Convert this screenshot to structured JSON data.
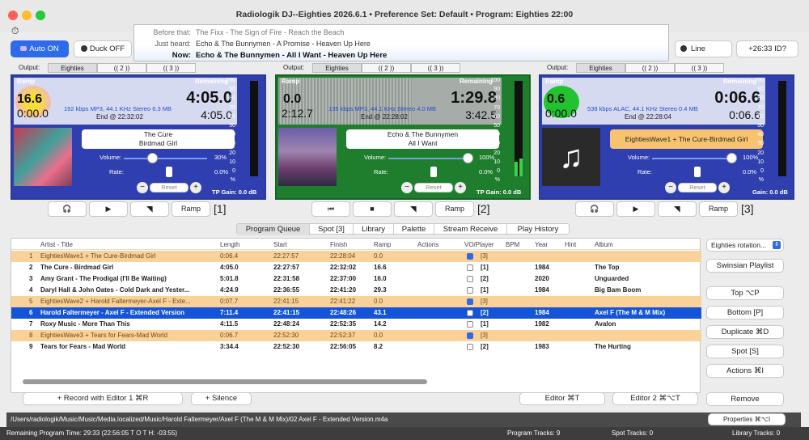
{
  "window": {
    "title": "Radiologik DJ--Eighties 2026.6.1   •   Preference Set: Default   •   Program: Eighties 22:00"
  },
  "toolbar": {
    "auto_label": "Auto ON",
    "duck_label": "Duck OFF",
    "line_label": "Line",
    "time_label": "+26:33  ID?"
  },
  "now_playing": {
    "before_label": "Before that:",
    "before_value": "The Fixx - The Sign of Fire - Reach the Beach",
    "just_label": "Just heard:",
    "just_value": "Echo & The Bunnymen - A Promise - Heaven Up Here",
    "now_label": "Now:",
    "now_value": "Echo & The Bunnymen - All I Want - Heaven Up Here"
  },
  "outputs": [
    {
      "label": "Output:",
      "tabs": [
        "Eighties",
        "(( 2 ))",
        "(( 3 ))"
      ]
    },
    {
      "label": "Output:",
      "tabs": [
        "Eighties",
        "(( 2 ))",
        "(( 3 ))"
      ]
    },
    {
      "label": "Output:",
      "tabs": [
        "Eighties",
        "(( 2 ))",
        "(( 3 ))"
      ]
    }
  ],
  "meter_scale": [
    "100",
    "90",
    "80",
    "70",
    "60",
    "50",
    "40",
    "30",
    "20",
    "10",
    "0",
    "%"
  ],
  "decks": [
    {
      "ramp_label": "Ramp",
      "remaining_label": "Remaining",
      "ramp_value": "16.6",
      "elapsed": "0:00.0",
      "remaining_big": "4:05.0",
      "remaining_small": "4:05.0",
      "format": "192 kbps MP3, 44.1 KHz Stereo 6.3 MB",
      "end": "End @ 22:32:02",
      "artist": "The Cure",
      "title": "Birdmad Girl",
      "volume_label": "Volume:",
      "volume_value": "30%",
      "rate_label": "Rate:",
      "rate_value": "0.0%",
      "reset_label": "Reset",
      "gain": "TP Gain: 0.0 dB",
      "color": "#2f3fb0"
    },
    {
      "ramp_label": "Ramp",
      "remaining_label": "Remaining",
      "ramp_value": "0.0",
      "elapsed": "2:12.7",
      "remaining_big": "1:29.8",
      "remaining_small": "3:42.5",
      "format": "135 kbps MP3, 44.1 KHz Stereo 4.0 MB",
      "end": "End @ 22:28:02",
      "artist": "Echo & The Bunnymen",
      "title": "All I Want",
      "volume_label": "Volume:",
      "volume_value": "100%",
      "rate_label": "Rate:",
      "rate_value": "0.0%",
      "reset_label": "Reset",
      "gain": "TP Gain: 0.0 dB",
      "color": "#1f7d2e"
    },
    {
      "ramp_label": "Ramp",
      "remaining_label": "Remaining",
      "ramp_value": "0.6",
      "elapsed": "0:00.0",
      "remaining_big": "0:06.6",
      "remaining_small": "0:06.6",
      "format": "538 kbps ALAC, 44.1 KHz Stereo 0.4 MB",
      "end": "End @ 22:28:04",
      "artist": "EightiesWave1 + The Cure-Birdmad Girl",
      "title": "",
      "volume_label": "Volume:",
      "volume_value": "100%",
      "rate_label": "Rate:",
      "rate_value": "0.0%",
      "reset_label": "Reset",
      "gain": "Gain: 0.0 dB",
      "color": "#2f3fb0"
    }
  ],
  "deck_controls": [
    {
      "ramp_label": "Ramp",
      "num": "[1]"
    },
    {
      "ramp_label": "Ramp",
      "num": "[2]"
    },
    {
      "ramp_label": "Ramp",
      "num": "[3]"
    }
  ],
  "panel_tabs": [
    "Program Queue",
    "Spot [3]",
    "Library",
    "Palette",
    "Stream Receive",
    "Play History"
  ],
  "table": {
    "headers": [
      "Artist - Title",
      "Length",
      "Start",
      "Finish",
      "Ramp",
      "Actions",
      "VO/Player",
      "BPM",
      "Year",
      "Hint",
      "Album"
    ],
    "rows": [
      {
        "n": "1",
        "title": "EightiesWave1 + The Cure-Birdmad Girl",
        "length": "0:06.4",
        "start": "22:27:57",
        "finish": "22:28:04",
        "ramp": "0.0",
        "vo": true,
        "player": "[3]",
        "year": "",
        "album": "",
        "style": "orange"
      },
      {
        "n": "2",
        "title": "The Cure - Birdmad Girl",
        "length": "4:05.0",
        "start": "22:27:57",
        "finish": "22:32:02",
        "ramp": "16.6",
        "vo": false,
        "player": "[1]",
        "year": "1984",
        "album": "The Top",
        "style": "bold"
      },
      {
        "n": "3",
        "title": "Amy Grant - The Prodigal (I'll Be Waiting)",
        "length": "5:01.8",
        "start": "22:31:58",
        "finish": "22:37:00",
        "ramp": "16.0",
        "vo": false,
        "player": "[2]",
        "year": "2020",
        "album": "Unguarded",
        "style": "bold"
      },
      {
        "n": "4",
        "title": "Daryl Hall & John Oates - Cold Dark and Yester...",
        "length": "4:24.9",
        "start": "22:36:55",
        "finish": "22:41:20",
        "ramp": "29.3",
        "vo": false,
        "player": "[1]",
        "year": "1984",
        "album": "Big Bam Boom",
        "style": "bold"
      },
      {
        "n": "5",
        "title": "EightiesWave2 + Harold Faltermeyer-Axel F - Exte...",
        "length": "0:07.7",
        "start": "22:41:15",
        "finish": "22:41:22",
        "ramp": "0.0",
        "vo": true,
        "player": "[3]",
        "year": "",
        "album": "",
        "style": "orange"
      },
      {
        "n": "6",
        "title": "Harold Faltermeyer - Axel F - Extended Version",
        "length": "7:11.4",
        "start": "22:41:15",
        "finish": "22:48:26",
        "ramp": "43.1",
        "vo": false,
        "player": "[2]",
        "year": "1984",
        "album": "Axel F (The M & M Mix)",
        "style": "selected"
      },
      {
        "n": "7",
        "title": "Roxy Music - More Than This",
        "length": "4:11.5",
        "start": "22:48:24",
        "finish": "22:52:35",
        "ramp": "14.2",
        "vo": false,
        "player": "[1]",
        "year": "1982",
        "album": "Avalon",
        "style": "bold"
      },
      {
        "n": "8",
        "title": "EightiesWave3 + Tears for Fears-Mad World",
        "length": "0:06.7",
        "start": "22:52:30",
        "finish": "22:52:37",
        "ramp": "0.0",
        "vo": true,
        "player": "[3]",
        "year": "",
        "album": "",
        "style": "orange"
      },
      {
        "n": "9",
        "title": "Tears for Fears - Mad World",
        "length": "3:34.4",
        "start": "22:52:30",
        "finish": "22:56:05",
        "ramp": "8.2",
        "vo": false,
        "player": "[2]",
        "year": "1983",
        "album": "The Hurting",
        "style": "bold"
      }
    ]
  },
  "side": {
    "rotation": "Eighties rotation...",
    "swinsian": "Swinsian Playlist",
    "top": "Top ⌥P",
    "bottom": "Bottom [P]",
    "duplicate": "Duplicate ⌘D",
    "spot": "Spot [S]",
    "actions": "Actions ⌘I",
    "remove": "Remove"
  },
  "bottom_buttons": {
    "record": "+ Record with Editor 1 ⌘R",
    "silence": "+ Silence",
    "editor": "Editor ⌘T",
    "editor2": "Editor 2 ⌘⌥T"
  },
  "path": "/Users/radiologik/Music/Music/Media.localized/Music/Harold Faltermeyer/Axel F (The M & M Mix)/02 Axel F - Extended Version.m4a",
  "properties": "Properties ⌘⌥I",
  "status": {
    "remaining": "Remaining Program Time: 29:33   (22:56:05  T O T H: -03:55)",
    "program_tracks": "Program Tracks: 9",
    "spot_tracks": "Spot Tracks: 0",
    "library_tracks": "Library Tracks: 0"
  }
}
